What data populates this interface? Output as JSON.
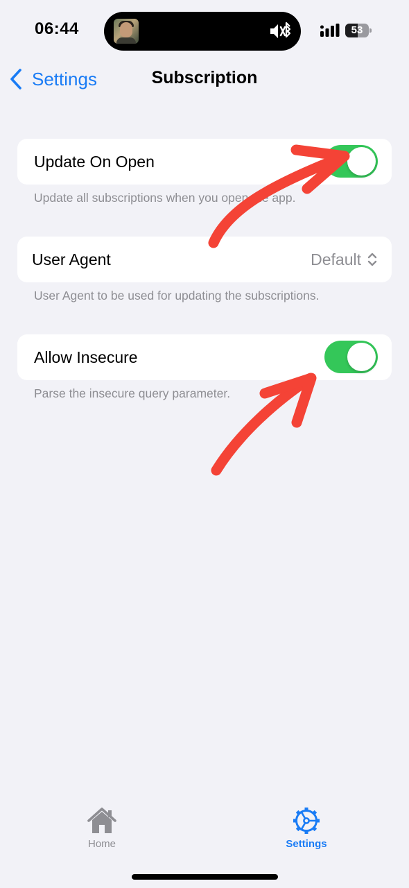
{
  "status_bar": {
    "time": "06:44",
    "battery_level": "53",
    "battery_fraction": 0.53,
    "island_icons": [
      "avatar",
      "sound-icon"
    ]
  },
  "nav": {
    "back_label": "Settings",
    "title": "Subscription"
  },
  "settings": {
    "update_on_open": {
      "label": "Update On Open",
      "enabled": true,
      "footer": "Update all subscriptions when you open the app."
    },
    "user_agent": {
      "label": "User Agent",
      "value": "Default",
      "footer": "User Agent to be used for updating the subscriptions."
    },
    "allow_insecure": {
      "label": "Allow Insecure",
      "enabled": true,
      "footer": "Parse the insecure query parameter."
    }
  },
  "tab_bar": {
    "home_label": "Home",
    "settings_label": "Settings",
    "selected": "Settings"
  },
  "colors": {
    "accent": "#1a7cf5",
    "toggle_on": "#34c759",
    "annotation_arrow": "#f44336",
    "background": "#f2f2f7",
    "secondary_text": "#8e8e93",
    "tab_inactive": "#8e8e93"
  }
}
